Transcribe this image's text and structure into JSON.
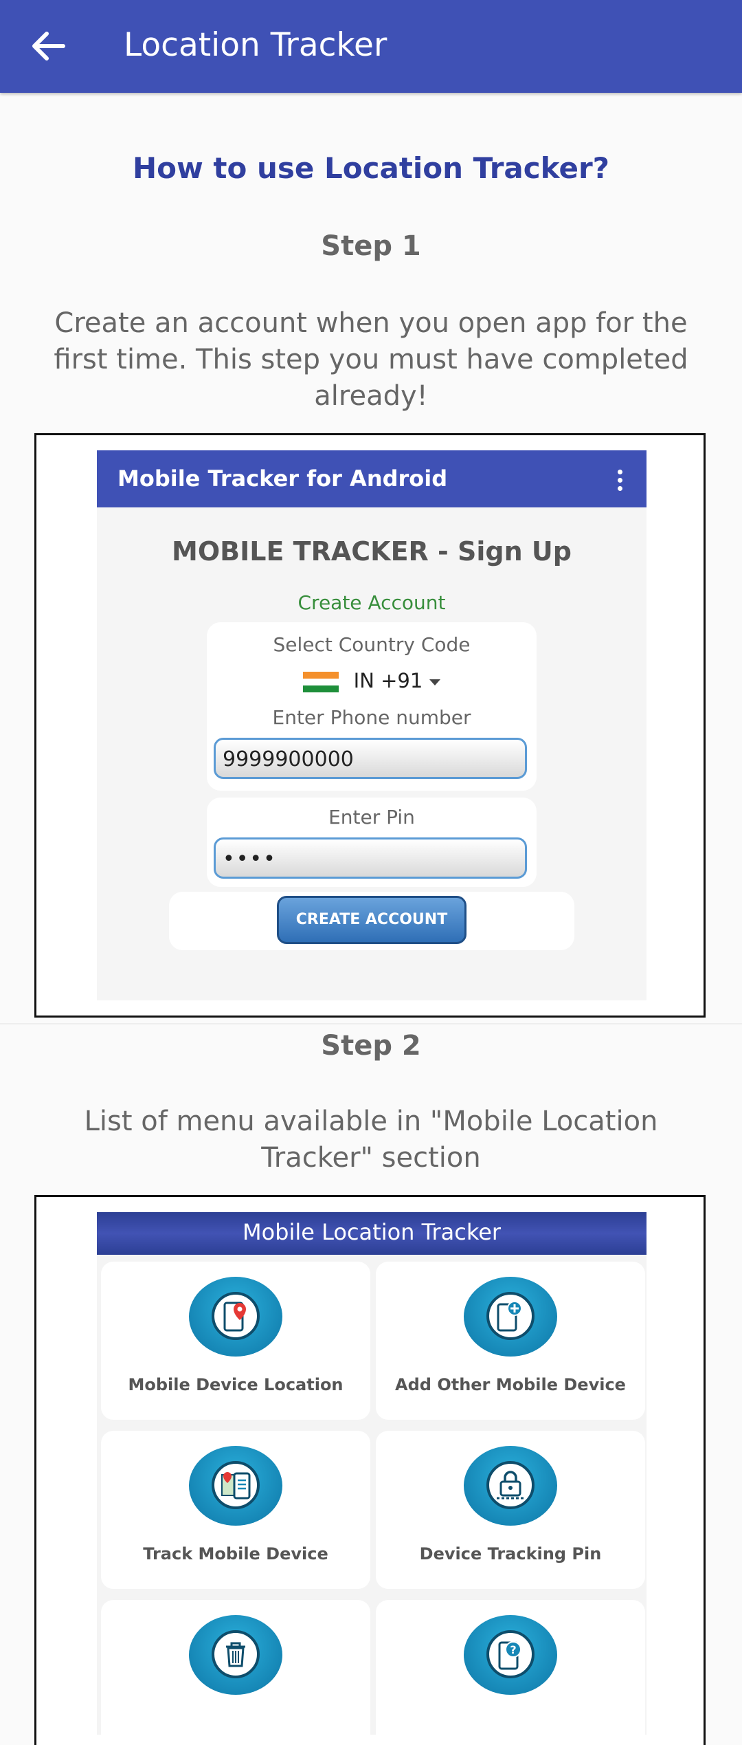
{
  "appbar": {
    "title": "Location Tracker"
  },
  "content": {
    "heading": "How to use Location Tracker?",
    "step1": {
      "title": "Step 1",
      "description": "Create an account when you open app for the first time. This step you must have completed already!",
      "screenshot": {
        "bar_title": "Mobile Tracker for Android",
        "signup_title": "MOBILE TRACKER - Sign Up",
        "create_account_label": "Create Account",
        "country_code_label": "Select Country Code",
        "country_code_value": "IN  +91",
        "phone_label": "Enter Phone number",
        "phone_value": "9999900000",
        "pin_label": "Enter Pin",
        "pin_value": "••••",
        "button_label": "CREATE ACCOUNT"
      }
    },
    "step2": {
      "title": "Step 2",
      "description": "List of menu available in \"Mobile Location Tracker\" section",
      "screenshot": {
        "bar_title": "Mobile Location Tracker",
        "tiles": [
          {
            "label": "Mobile Device Location",
            "icon": "location-pin-icon"
          },
          {
            "label": "Add Other Mobile Device",
            "icon": "add-device-icon"
          },
          {
            "label": "Track Mobile Device",
            "icon": "track-map-icon"
          },
          {
            "label": "Device Tracking Pin",
            "icon": "lock-icon"
          },
          {
            "label": "",
            "icon": "delete-icon"
          },
          {
            "label": "",
            "icon": "help-icon"
          }
        ]
      }
    }
  },
  "colors": {
    "primary": "#3f51b5",
    "heading": "#303f9f",
    "text": "#666666",
    "accent_green": "#388e3c",
    "icon_teal": "#1687b6"
  }
}
